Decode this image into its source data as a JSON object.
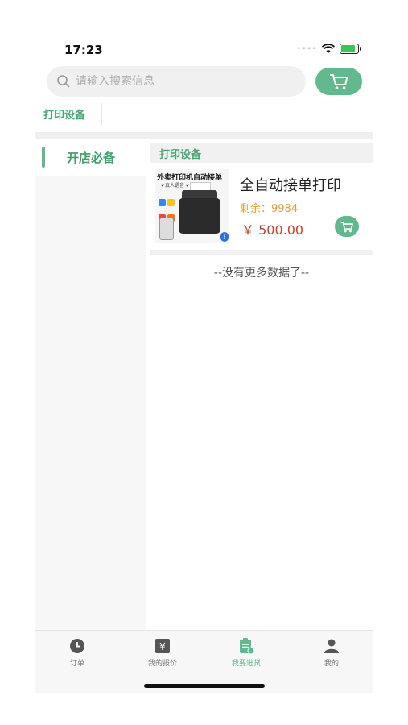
{
  "status_bar": {
    "time": "17:23"
  },
  "search": {
    "placeholder": "请输入搜索信息"
  },
  "top_tabs": [
    {
      "label": "打印设备"
    }
  ],
  "sidebar": {
    "items": [
      {
        "label": "开店必备",
        "selected": true
      }
    ]
  },
  "section": {
    "title": "打印设备"
  },
  "products": [
    {
      "name": "全自动接单打印",
      "stock_text": "剩余：9984",
      "price": "￥ 500.00",
      "image_text_1": "外卖打印机自动接单",
      "image_text_2": "✔真人语音 ✔自动接单"
    }
  ],
  "list_end_text": "--没有更多数据了--",
  "tabbar": {
    "items": [
      {
        "label": "订单",
        "icon": "clock-icon",
        "active": false
      },
      {
        "label": "我的报价",
        "icon": "yuan-icon",
        "active": false
      },
      {
        "label": "我要进货",
        "icon": "clipboard-icon",
        "active": true
      },
      {
        "label": "我的",
        "icon": "user-icon",
        "active": false
      }
    ]
  },
  "colors": {
    "accent": "#62b98e",
    "price": "#d33a2c",
    "stock": "#e39a3d"
  }
}
